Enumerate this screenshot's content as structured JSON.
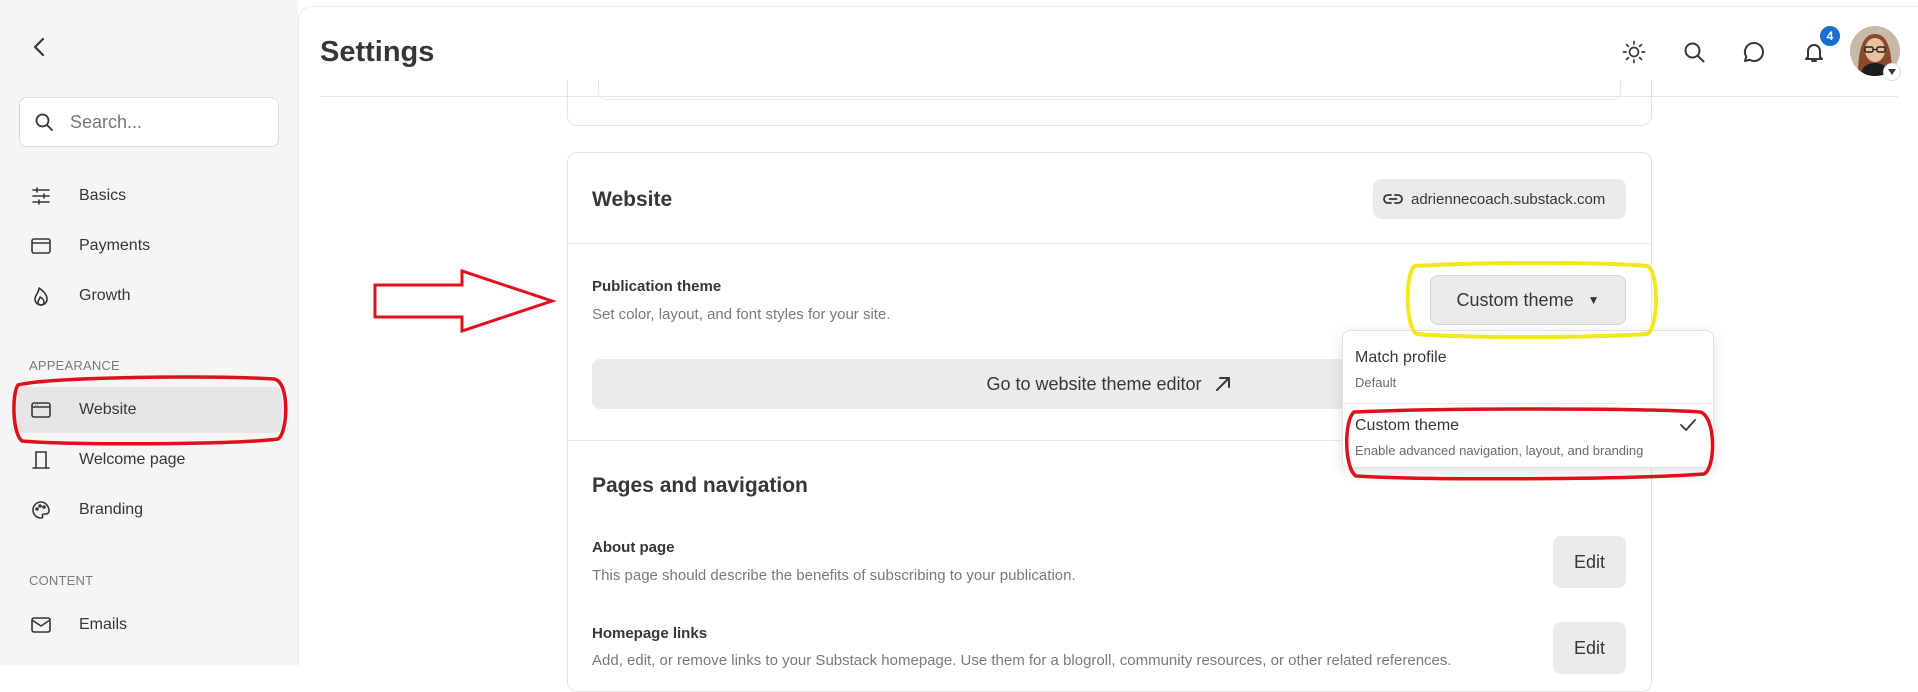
{
  "sidebar": {
    "search_placeholder": "Search...",
    "items_top": [
      {
        "label": "Basics",
        "icon": "sliders-icon"
      },
      {
        "label": "Payments",
        "icon": "credit-card-icon"
      },
      {
        "label": "Growth",
        "icon": "flame-icon"
      }
    ],
    "section_appearance": "APPEARANCE",
    "items_appearance": [
      {
        "label": "Website",
        "icon": "browser-window-icon",
        "active": true
      },
      {
        "label": "Welcome page",
        "icon": "door-icon"
      },
      {
        "label": "Branding",
        "icon": "palette-icon"
      }
    ],
    "section_content": "CONTENT",
    "items_content": [
      {
        "label": "Emails",
        "icon": "mail-icon"
      }
    ]
  },
  "header": {
    "title": "Settings",
    "notification_count": "4"
  },
  "website_card": {
    "title": "Website",
    "url": "adriennecoach.substack.com",
    "publication_theme": {
      "label": "Publication theme",
      "description": "Set color, layout, and font styles for your site.",
      "selected": "Custom theme"
    },
    "theme_editor_button": "Go to website theme editor",
    "theme_menu": [
      {
        "title": "Match profile",
        "subtitle": "Default",
        "checked": false
      },
      {
        "title": "Custom theme",
        "subtitle": "Enable advanced navigation, layout, and branding",
        "checked": true
      }
    ]
  },
  "pages_nav": {
    "title": "Pages and navigation",
    "about": {
      "label": "About page",
      "description": "This page should describe the benefits of subscribing to your publication.",
      "button": "Edit"
    },
    "homepage_links": {
      "label": "Homepage links",
      "description": "Add, edit, or remove links to your Substack homepage. Use them for a blogroll, community resources, or other related references.",
      "button": "Edit"
    }
  },
  "colors": {
    "annotation_red": "#e0101a",
    "annotation_yellow": "#f2e81c",
    "badge_blue": "#1c6fd1"
  }
}
